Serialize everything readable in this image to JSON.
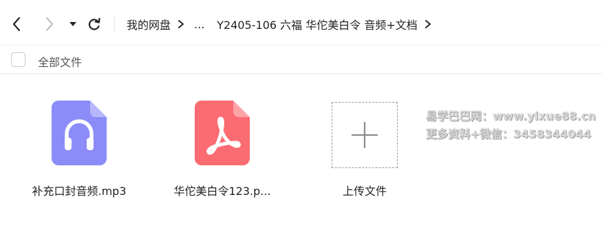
{
  "breadcrumb": {
    "root": "我的网盘",
    "ellipsis": "...",
    "current": "Y2405-106 六福 华佗美白令 音频+文档"
  },
  "selectbar": {
    "label": "全部文件"
  },
  "files": [
    {
      "name": "补充口封音频.mp3",
      "type": "audio",
      "color": "#8b8cf8"
    },
    {
      "name": "华佗美白令123.p...",
      "type": "pdf",
      "color": "#fb6b72"
    }
  ],
  "upload": {
    "label": "上传文件"
  },
  "watermark": {
    "line1": "易学巴巴网：www.yixue88.cn",
    "line2": "更多资料+微信：3458344044"
  }
}
